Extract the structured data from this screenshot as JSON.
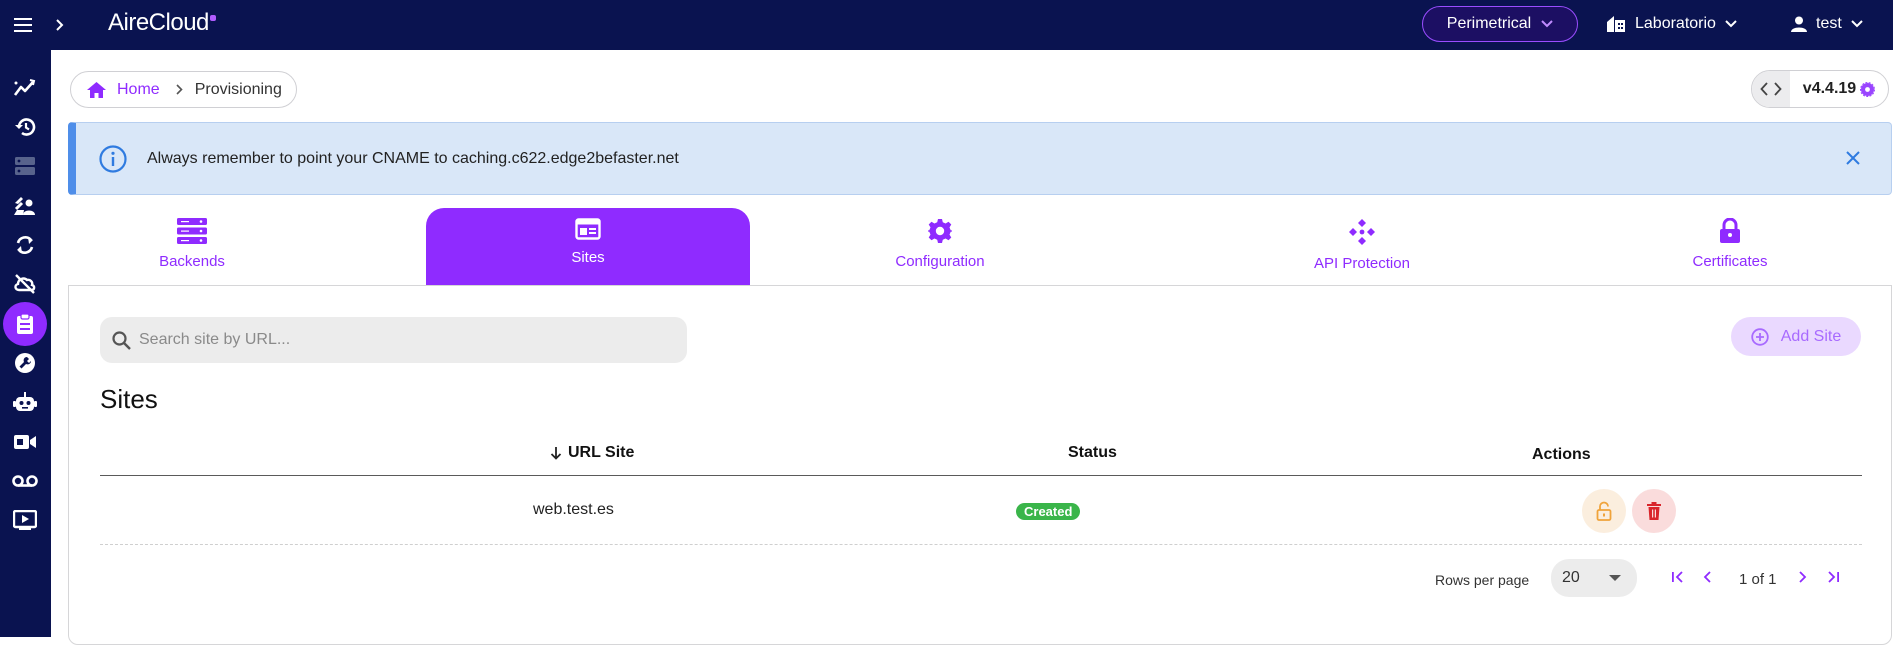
{
  "topbar": {
    "logo": "AireCloud",
    "environment": "Perimetrical",
    "organization": "Laboratorio",
    "user": "test"
  },
  "sidebar": {
    "items": [
      {
        "icon": "analytics-icon",
        "active": false
      },
      {
        "icon": "history-icon",
        "active": false
      },
      {
        "icon": "servers-icon",
        "active": false
      },
      {
        "icon": "security-check-icon",
        "active": false
      },
      {
        "icon": "sync-icon",
        "active": false
      },
      {
        "icon": "cloud-off-icon",
        "active": false
      },
      {
        "icon": "clipboard-icon",
        "active": true
      },
      {
        "icon": "wrench-icon",
        "active": false
      },
      {
        "icon": "robot-icon",
        "active": false
      },
      {
        "icon": "video-camera-icon",
        "active": false
      },
      {
        "icon": "voicemail-icon",
        "active": false
      },
      {
        "icon": "play-screen-icon",
        "active": false
      }
    ]
  },
  "breadcrumb": {
    "home": "Home",
    "current": "Provisioning"
  },
  "version": "v4.4.19",
  "alert": {
    "message": "Always remember to point your CNAME to caching.c622.edge2befaster.net"
  },
  "tabs": [
    {
      "label": "Backends",
      "icon": "servers-icon",
      "active": false
    },
    {
      "label": "Sites",
      "icon": "browser-window-icon",
      "active": true
    },
    {
      "label": "Configuration",
      "icon": "gear-icon",
      "active": false
    },
    {
      "label": "API Protection",
      "icon": "api-nodes-icon",
      "active": false
    },
    {
      "label": "Certificates",
      "icon": "lock-icon",
      "active": false
    }
  ],
  "search": {
    "placeholder": "Search site by URL...",
    "value": ""
  },
  "add_site_label": "Add Site",
  "sites_title": "Sites",
  "table": {
    "columns": [
      "URL Site",
      "Status",
      "Actions"
    ],
    "sorted_column": "URL Site",
    "rows": [
      {
        "url": "web.test.es",
        "status": "Created"
      }
    ]
  },
  "pagination": {
    "rows_per_page_label": "Rows per page",
    "rows_per_page": "20",
    "page_info": "1 of 1"
  },
  "colors": {
    "topbar": "#0a1350",
    "accent": "#8f2bff",
    "alert_bg": "#d9e7f8",
    "status_created": "#3ab54a",
    "lock_action": "#f0a33a",
    "delete_action": "#d9252b"
  }
}
